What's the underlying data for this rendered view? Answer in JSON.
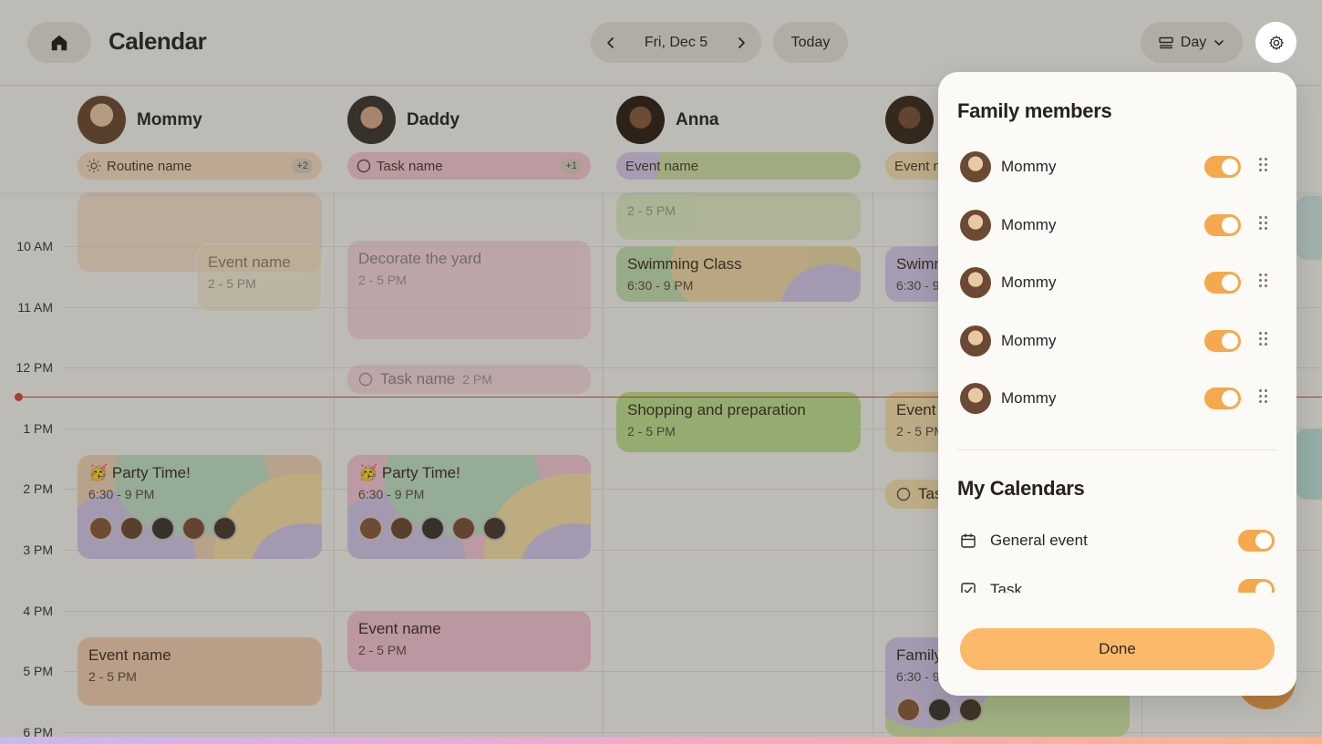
{
  "header": {
    "title": "Calendar",
    "date": "Fri, Dec 5",
    "today_label": "Today",
    "view_label": "Day",
    "icons": [
      "home-icon",
      "chevron-left-icon",
      "chevron-right-icon",
      "view-list-icon",
      "chevron-down-icon",
      "gear-icon"
    ]
  },
  "members": [
    {
      "name": "Mommy",
      "chip": "Routine name",
      "chip_badge": "+2",
      "chip_icon": "sun-icon"
    },
    {
      "name": "Daddy",
      "chip": "Task name",
      "chip_badge": "+1",
      "chip_icon": "circle-icon"
    },
    {
      "name": "Anna",
      "chip": "Event name",
      "chip_badge": "",
      "chip_icon": ""
    },
    {
      "name": "",
      "chip": "Event n",
      "chip_badge": "",
      "chip_icon": ""
    }
  ],
  "times": [
    "10 AM",
    "11 AM",
    "12 PM",
    "1 PM",
    "2 PM",
    "3 PM",
    "4 PM",
    "5 PM",
    "6 PM"
  ],
  "events": {
    "mommy_event_1": {
      "title": "Event name",
      "time": "2 - 5 PM"
    },
    "mommy_party": {
      "title": "🥳 Party Time!",
      "time": "6:30 - 9 PM"
    },
    "mommy_event_2": {
      "title": "Event name",
      "time": "2 - 5 PM"
    },
    "daddy_yard": {
      "title": "Decorate the yard",
      "time": "2 - 5 PM"
    },
    "daddy_task": {
      "title": "Task name",
      "time": "2 PM"
    },
    "daddy_party": {
      "title": "🥳 Party Time!",
      "time": "6:30 - 9 PM"
    },
    "daddy_event": {
      "title": "Event name",
      "time": "2 - 5 PM"
    },
    "anna_top": {
      "time": "2 - 5 PM"
    },
    "anna_swim": {
      "title": "Swimming Class",
      "time": "6:30 - 9 PM"
    },
    "anna_shop": {
      "title": "Shopping and preparation",
      "time": "2 - 5 PM"
    },
    "col4_swim": {
      "title": "Swimm",
      "time": "6:30 - 9"
    },
    "col4_event": {
      "title": "Event",
      "time": "2 - 5 PM"
    },
    "col4_task": {
      "title": "Tas"
    },
    "col4_family": {
      "title": "Family",
      "time": "6:30 - 9"
    }
  },
  "panel": {
    "family_title": "Family members",
    "family": [
      {
        "name": "Mommy",
        "enabled": true
      },
      {
        "name": "Mommy",
        "enabled": true
      },
      {
        "name": "Mommy",
        "enabled": true
      },
      {
        "name": "Mommy",
        "enabled": true
      },
      {
        "name": "Mommy",
        "enabled": true
      }
    ],
    "calendars_title": "My Calendars",
    "calendars": [
      {
        "name": "General event",
        "icon": "calendar-icon",
        "enabled": true
      },
      {
        "name": "Task",
        "icon": "checkbox-icon",
        "enabled": true
      }
    ],
    "done_label": "Done"
  },
  "colors": {
    "accent": "#f5a84c",
    "done_button": "#fbb969",
    "now_line": "#d54a37",
    "panel_bg": "#fbfaf6",
    "app_bg": "#f6f4ef"
  }
}
